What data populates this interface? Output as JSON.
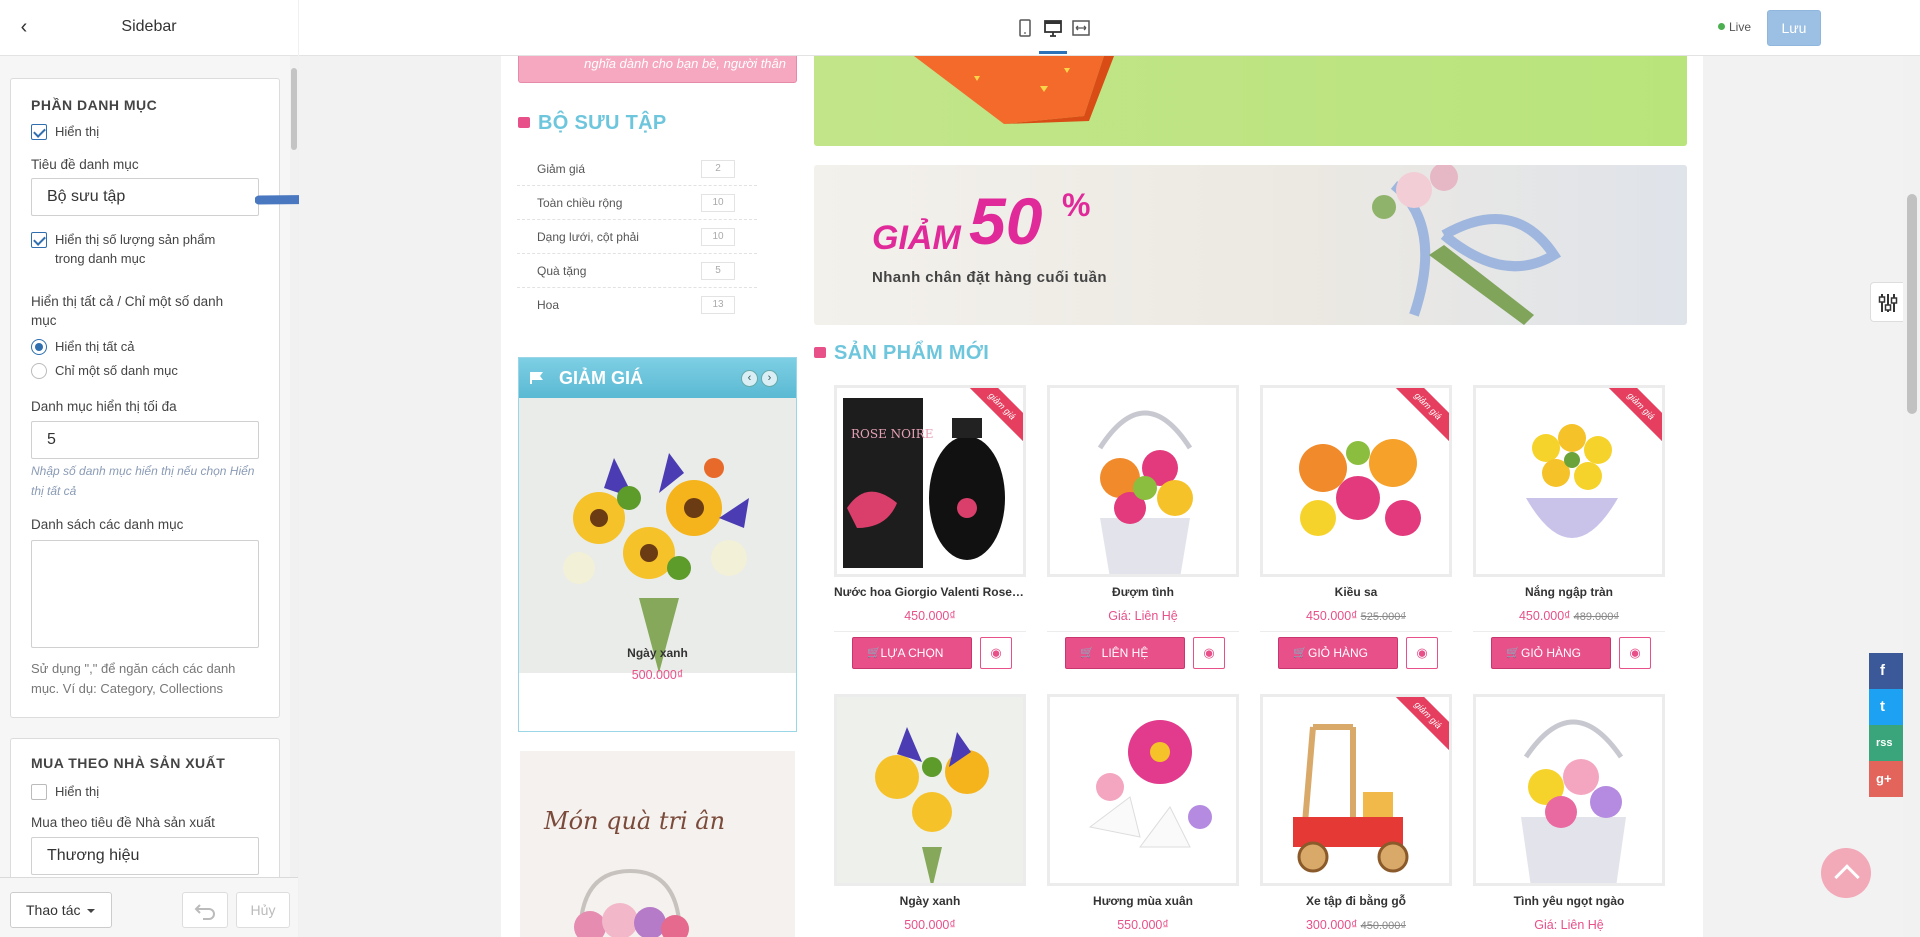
{
  "editor": {
    "title": "Sidebar",
    "category_section": {
      "title": "PHẦN DANH MỤC",
      "show_label": "Hiển thị",
      "title_label": "Tiêu đề danh mục",
      "title_value": "Bộ sưu tập",
      "show_count_label_1": "Hiển thị số lượng sản phẩm",
      "show_count_label_2": "trong danh mục",
      "scope_label_1": "Hiển thị tất cả / Chỉ một số danh",
      "scope_label_2": "mục",
      "option_all": "Hiển thị tất cả",
      "option_some": "Chỉ một số danh mục",
      "max_label": "Danh mục hiển thị tối đa",
      "max_value": "5",
      "max_hint_1": "Nhập số danh mục hiển thị nếu chọn Hiển",
      "max_hint_2": "thị tất cả",
      "list_label": "Danh sách các danh mục",
      "list_value": "",
      "list_help_1": "Sử dụng \",\" để ngăn cách các danh",
      "list_help_2": "mục. Ví dụ: Category, Collections"
    },
    "vendor_section": {
      "title": "MUA THEO NHÀ SẢN XUẤT",
      "show_label": "Hiển thị",
      "title_label": "Mua theo tiêu đề Nhà sản xuất",
      "title_value": "Thương hiệu"
    },
    "footer": {
      "actions_label": "Thao tác",
      "cancel_label": "Hủy"
    }
  },
  "toolbar": {
    "live_label": "Live",
    "save_label": "Lưu"
  },
  "store": {
    "promo_text": "nghĩa dành cho bạn bè, người thân",
    "collection_title": "BỘ SƯU TẬP",
    "categories": [
      {
        "name": "Giảm giá",
        "count": "2"
      },
      {
        "name": "Toàn chiều rộng",
        "count": "10"
      },
      {
        "name": "Dạng lưới, cột phải",
        "count": "10"
      },
      {
        "name": "Quà tặng",
        "count": "5"
      },
      {
        "name": "Hoa",
        "count": "13"
      }
    ],
    "sale_widget": {
      "title": "GIẢM GIÁ",
      "product_name": "Ngày xanh",
      "product_price": "500.000₫"
    },
    "gift_banner_text": "Món quà tri ân",
    "sale_banner": {
      "word": "GIẢM",
      "percent": "50",
      "percent_sign": "%",
      "subtitle": "Nhanh chân đặt hàng cuối tuần"
    },
    "new_products_title": "SẢN PHẨM MỚI",
    "ribbon_label": "giảm giá",
    "products": [
      {
        "name": "Nước hoa Giorgio Valenti Rose Noire",
        "price": "450.000₫",
        "old_price": "",
        "button": "LỰA CHỌN",
        "sale": true
      },
      {
        "name": "Đượm tình",
        "price": "Giá: Liên Hệ",
        "old_price": "",
        "button": "LIÊN HỆ",
        "sale": false
      },
      {
        "name": "Kiều sa",
        "price": "450.000₫",
        "old_price": "525.000₫",
        "button": "GIỎ HÀNG",
        "sale": true
      },
      {
        "name": "Nắng ngập tràn",
        "price": "450.000₫",
        "old_price": "489.000₫",
        "button": "GIỎ HÀNG",
        "sale": true
      },
      {
        "name": "Ngày xanh",
        "price": "500.000₫",
        "old_price": "",
        "button": "",
        "sale": false
      },
      {
        "name": "Hương mùa xuân",
        "price": "550.000₫",
        "old_price": "",
        "button": "",
        "sale": false
      },
      {
        "name": "Xe tập đi bằng gỗ",
        "price": "300.000₫",
        "old_price": "450.000₫",
        "button": "",
        "sale": true
      },
      {
        "name": "Tình yêu ngọt ngào",
        "price": "Giá: Liên Hệ",
        "old_price": "",
        "button": "",
        "sale": false
      }
    ],
    "social": [
      "f",
      "t",
      "rss",
      "g+"
    ]
  },
  "colors": {
    "accent_pink": "#e8508a",
    "accent_teal": "#6ec6dd",
    "primary_blue": "#2f6fb0"
  }
}
